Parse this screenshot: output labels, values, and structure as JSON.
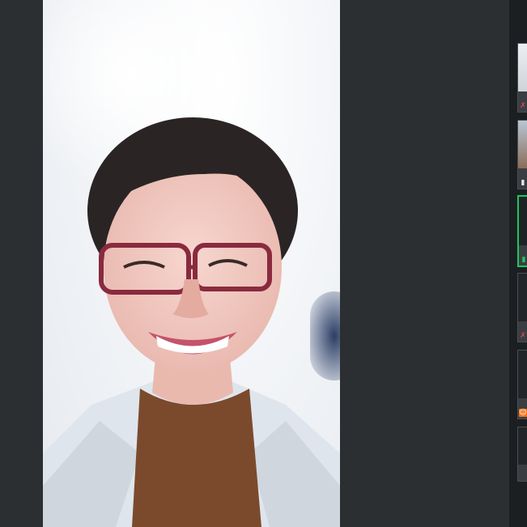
{
  "window": {
    "accent_color": "#22c55e",
    "background_color": "#2b2f32"
  },
  "main_video": {
    "participant": "active speaker",
    "icon": "video-feed"
  },
  "participants": [
    {
      "icon": "mic-muted-icon",
      "glyph": "✗"
    },
    {
      "icon": "mic-icon",
      "glyph": "▮"
    },
    {
      "icon": "mic-active-icon",
      "glyph": "▮",
      "speaking": true
    },
    {
      "icon": "mic-muted-icon",
      "glyph": "✗"
    },
    {
      "icon": "person-icon",
      "glyph": "☺"
    },
    {
      "icon": "none",
      "glyph": ""
    }
  ]
}
